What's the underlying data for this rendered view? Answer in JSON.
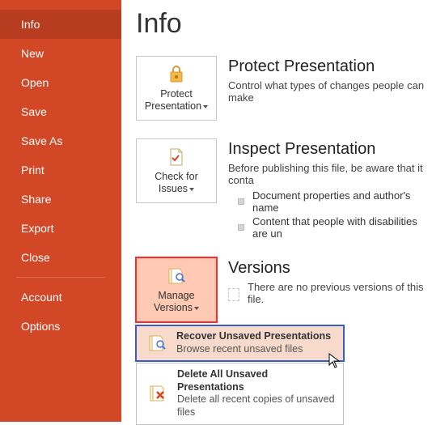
{
  "sidebar": {
    "items": [
      {
        "label": "Info",
        "active": true
      },
      {
        "label": "New"
      },
      {
        "label": "Open"
      },
      {
        "label": "Save"
      },
      {
        "label": "Save As"
      },
      {
        "label": "Print"
      },
      {
        "label": "Share"
      },
      {
        "label": "Export"
      },
      {
        "label": "Close"
      }
    ],
    "footer": [
      {
        "label": "Account"
      },
      {
        "label": "Options"
      }
    ]
  },
  "page_title": "Info",
  "sections": {
    "protect": {
      "tile_line1": "Protect",
      "tile_line2": "Presentation",
      "title": "Protect Presentation",
      "desc": "Control what types of changes people can make"
    },
    "inspect": {
      "tile_line1": "Check for",
      "tile_line2": "Issues",
      "title": "Inspect Presentation",
      "desc": "Before publishing this file, be aware that it conta",
      "bullets": [
        "Document properties and author's name",
        "Content that people with disabilities are un"
      ]
    },
    "versions": {
      "tile_line1": "Manage",
      "tile_line2": "Versions",
      "title": "Versions",
      "desc": "There are no previous versions of this file."
    }
  },
  "menu": {
    "recover": {
      "title": "Recover Unsaved Presentations",
      "sub": "Browse recent unsaved files"
    },
    "delete": {
      "title": "Delete All Unsaved Presentations",
      "sub": "Delete all recent copies of unsaved files"
    }
  }
}
